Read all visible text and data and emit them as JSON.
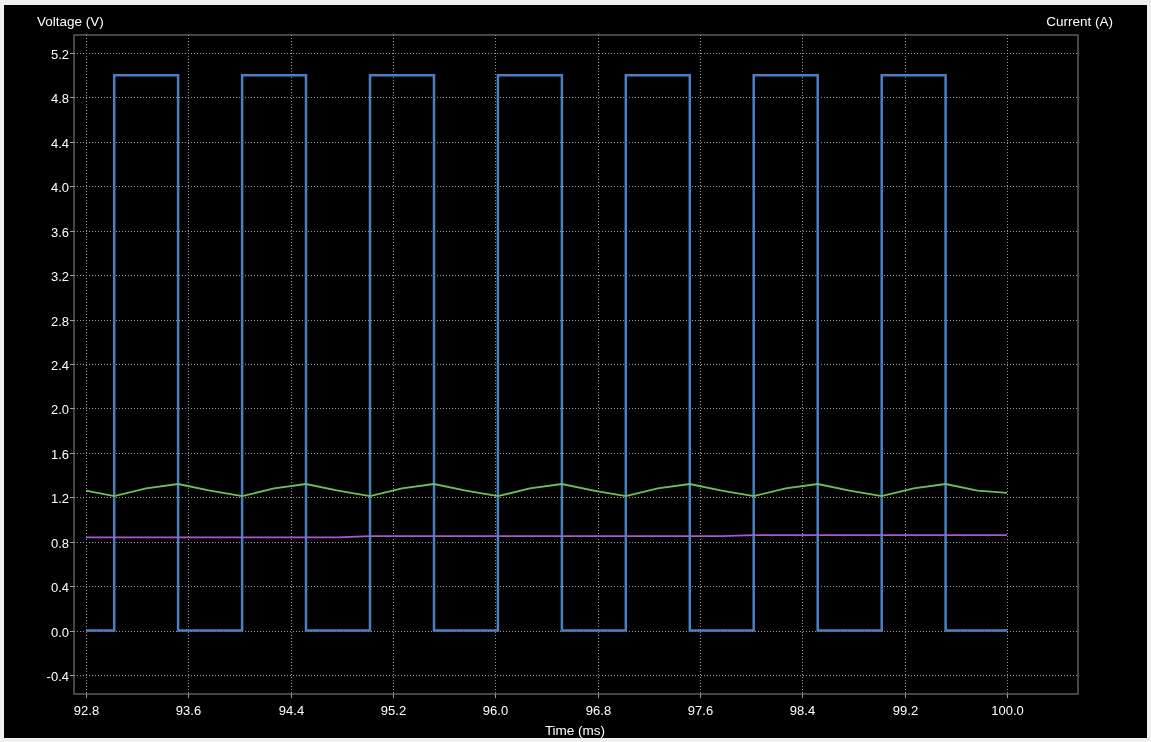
{
  "plot": {
    "right_axis_label": "Current (A)",
    "chart_data": {
      "type": "line",
      "grid": true,
      "ylabel": "Voltage (V)",
      "xlabel": "Time (ms)",
      "x": [
        92.8,
        93.02,
        93.02,
        93.27,
        93.52,
        93.52,
        93.77,
        94.02,
        94.02,
        94.27,
        94.52,
        94.52,
        94.77,
        95.02,
        95.02,
        95.27,
        95.52,
        95.52,
        95.77,
        96.02,
        96.02,
        96.27,
        96.52,
        96.52,
        96.77,
        97.02,
        97.02,
        97.27,
        97.52,
        97.52,
        97.77,
        98.02,
        98.02,
        98.27,
        98.52,
        98.52,
        98.77,
        99.02,
        99.02,
        99.27,
        99.52,
        99.52,
        99.77,
        100.0
      ],
      "series": [
        {
          "color": "#4a7fc0",
          "values": [
            0,
            0,
            5,
            5,
            5,
            0,
            0,
            0,
            5,
            5,
            5,
            0,
            0,
            0,
            5,
            5,
            5,
            0,
            0,
            0,
            5,
            5,
            5,
            0,
            0,
            0,
            5,
            5,
            5,
            0,
            0,
            0,
            5,
            5,
            5,
            0,
            0,
            0,
            5,
            5,
            5,
            0,
            0,
            0
          ]
        },
        {
          "color": "#6cc05c",
          "values": [
            1.26,
            1.21,
            1.21,
            1.28,
            1.32,
            1.32,
            1.26,
            1.21,
            1.21,
            1.28,
            1.32,
            1.32,
            1.26,
            1.21,
            1.21,
            1.28,
            1.32,
            1.32,
            1.26,
            1.21,
            1.21,
            1.28,
            1.32,
            1.32,
            1.26,
            1.21,
            1.21,
            1.28,
            1.32,
            1.32,
            1.26,
            1.21,
            1.21,
            1.28,
            1.32,
            1.32,
            1.26,
            1.21,
            1.21,
            1.28,
            1.32,
            1.32,
            1.26,
            1.24
          ]
        },
        {
          "color": "#a55bd0",
          "values": [
            0.84,
            0.84,
            0.84,
            0.84,
            0.84,
            0.84,
            0.84,
            0.84,
            0.84,
            0.84,
            0.84,
            0.84,
            0.84,
            0.85,
            0.85,
            0.85,
            0.85,
            0.85,
            0.85,
            0.85,
            0.85,
            0.85,
            0.85,
            0.85,
            0.85,
            0.85,
            0.85,
            0.85,
            0.85,
            0.85,
            0.85,
            0.86,
            0.86,
            0.86,
            0.86,
            0.86,
            0.86,
            0.86,
            0.86,
            0.86,
            0.86,
            0.86,
            0.86,
            0.86
          ]
        }
      ],
      "xlim": [
        92.706,
        100.555
      ],
      "ylim": [
        -0.571,
        5.362
      ],
      "xticks": [
        92.8,
        93.6,
        94.4,
        95.2,
        {
          "value": 96,
          "label": "96.0"
        },
        96.8,
        97.6,
        98.4,
        99.2,
        {
          "value": 100,
          "label": "100.0"
        }
      ],
      "yticks": [
        -0.4,
        {
          "value": 0,
          "label": "0.0"
        },
        0.4,
        0.8,
        1.2,
        1.6,
        {
          "value": 2,
          "label": "2.0"
        },
        2.4,
        2.8,
        3.2,
        3.6,
        {
          "value": 4,
          "label": "4.0"
        },
        4.4,
        4.8,
        5.2
      ]
    }
  }
}
